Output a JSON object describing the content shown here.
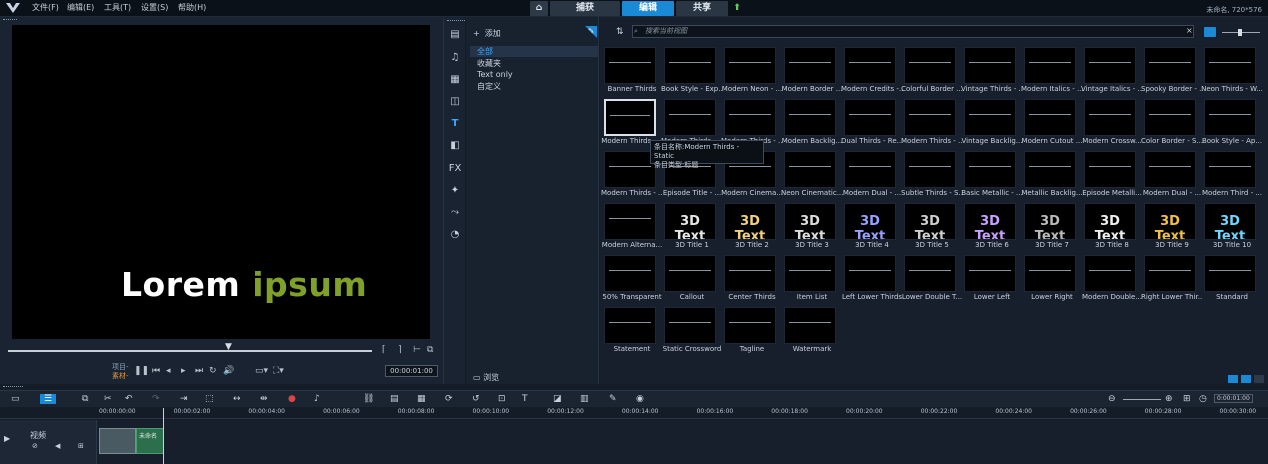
{
  "menu": {
    "file": "文件(F)",
    "edit": "编辑(E)",
    "tools": "工具(T)",
    "settings": "设置(S)",
    "help": "帮助(H)"
  },
  "tabs": {
    "capture": "捕获",
    "edit": "编辑",
    "share": "共享"
  },
  "project_info": "未命名, 720*576",
  "preview": {
    "text_word1": "Lorem",
    "text_word2": "ipsum",
    "project_label": "项目-",
    "clip_label": "素材-",
    "timecode": "00:00:01:00"
  },
  "library": {
    "add_label": "添加",
    "categories": [
      "全部",
      "收藏夹",
      "Text only",
      "自定义"
    ],
    "browse_label": "浏览",
    "search_placeholder": "搜索当前视图"
  },
  "tooltip": {
    "line1": "条目名称:Modern Thirds - Static",
    "line2": "条目类型:标题"
  },
  "titles": [
    [
      "Banner Thirds",
      "Book Style - Exp...",
      "Modern Neon - ...",
      "Modern Border ...",
      "Modern Credits -...",
      "Colorful Border ...",
      "Vintage Thirds - ...",
      "Modern Italics - ...",
      "Vintage Italics - ...",
      "Spooky Border - ...",
      "Neon Thirds - W..."
    ],
    [
      "Modern Thirds -...",
      "Modern Thirds - ...",
      "Modern Thirds - ...",
      "Modern Backlig...",
      "Dual Thirds - Re...",
      "Modern Thirds - ...",
      "Vintage Backlig...",
      "Modern Cutout ...",
      "Modern Crossw...",
      "Color Border - S...",
      "Book Style - Ap..."
    ],
    [
      "Modern Thirds - ...",
      "Episode Title - ...",
      "Modern Cinema...",
      "Neon Cinematic...",
      "Modern Dual - ...",
      "Subtle Thirds - S...",
      "Basic Metallic - ...",
      "Metallic Backlig...",
      "Episode Metalli...",
      "Modern Dual - ...",
      "Modern Third - ..."
    ],
    [
      "Modern Alterna...",
      "3D Title 1",
      "3D Title 2",
      "3D Title 3",
      "3D Title 4",
      "3D Title 5",
      "3D Title 6",
      "3D Title 7",
      "3D Title 8",
      "3D Title 9",
      "3D Title 10"
    ],
    [
      "50% Transparent",
      "Callout",
      "Center Thirds",
      "Item List",
      "Left Lower Thirds",
      "Lower Double T...",
      "Lower Left",
      "Lower Right",
      "Modern Double...",
      "Right Lower Thir...",
      "Standard"
    ],
    [
      "Statement",
      "Static Crossword",
      "Tagline",
      "Watermark"
    ]
  ],
  "ruler": [
    "00:00:00:00",
    "00:00:02:00",
    "00:00:04:00",
    "00:00:06:00",
    "00:00:08:00",
    "00:00:10:00",
    "00:00:12:00",
    "00:00:14:00",
    "00:00:16:00",
    "00:00:18:00",
    "00:00:20:00",
    "00:00:22:00",
    "00:00:24:00",
    "00:00:26:00",
    "00:00:28:00",
    "00:00:30:00"
  ],
  "track": {
    "name": "视频",
    "clip2_label": "未命名"
  },
  "zoom_timecode": "0:00:01:00",
  "colors": {
    "accent": "#1b8ad6",
    "brand_green": "#7fa12a"
  }
}
